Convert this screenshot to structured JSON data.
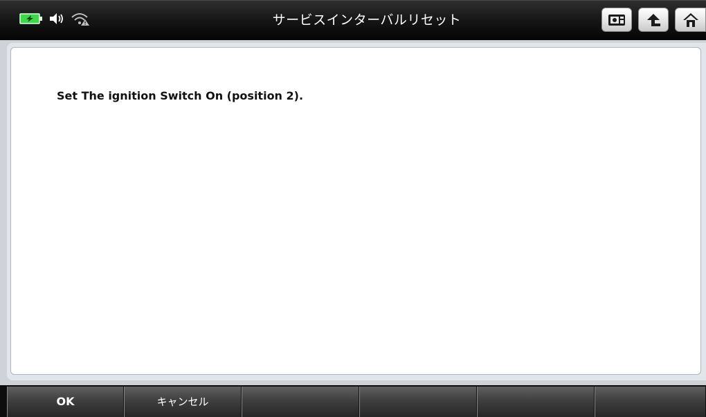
{
  "header": {
    "title": "サービスインターバルリセット",
    "status_icons": [
      "battery-charging-icon",
      "speaker-icon",
      "wifi-warning-icon"
    ],
    "buttons": [
      "screenshot-icon",
      "back-arrow-icon",
      "home-icon"
    ]
  },
  "main": {
    "message": "Set The ignition Switch On (position 2)."
  },
  "footer": {
    "buttons": [
      {
        "label": "OK"
      },
      {
        "label": "キャンセル"
      },
      {
        "label": ""
      },
      {
        "label": ""
      },
      {
        "label": ""
      },
      {
        "label": ""
      }
    ]
  },
  "colors": {
    "header_bg": "#111111",
    "battery_green": "#3fd84a",
    "content_bg": "#ffffff",
    "footer_button": "#3f3f3f"
  }
}
